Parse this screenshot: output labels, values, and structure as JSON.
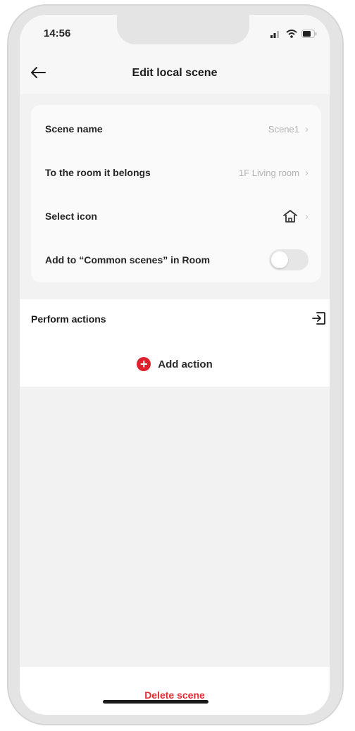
{
  "status_bar": {
    "time": "14:56",
    "icons": [
      "signal-icon",
      "wifi-icon",
      "battery-icon"
    ]
  },
  "header": {
    "back_icon": "back-arrow-icon",
    "title": "Edit local scene"
  },
  "settings": {
    "scene_name": {
      "label": "Scene name",
      "value": "Scene1"
    },
    "room": {
      "label": "To the room it belongs",
      "value": "1F Living room"
    },
    "icon": {
      "label": "Select icon",
      "icon": "home-icon"
    },
    "common_scenes": {
      "label": "Add to “Common scenes” in Room",
      "enabled": false
    }
  },
  "actions": {
    "title": "Perform actions",
    "add_label": "Add action"
  },
  "footer": {
    "delete_label": "Delete scene"
  },
  "colors": {
    "accent_red": "#e0202c",
    "background": "#f2f2f2",
    "card": "#fafafa"
  }
}
